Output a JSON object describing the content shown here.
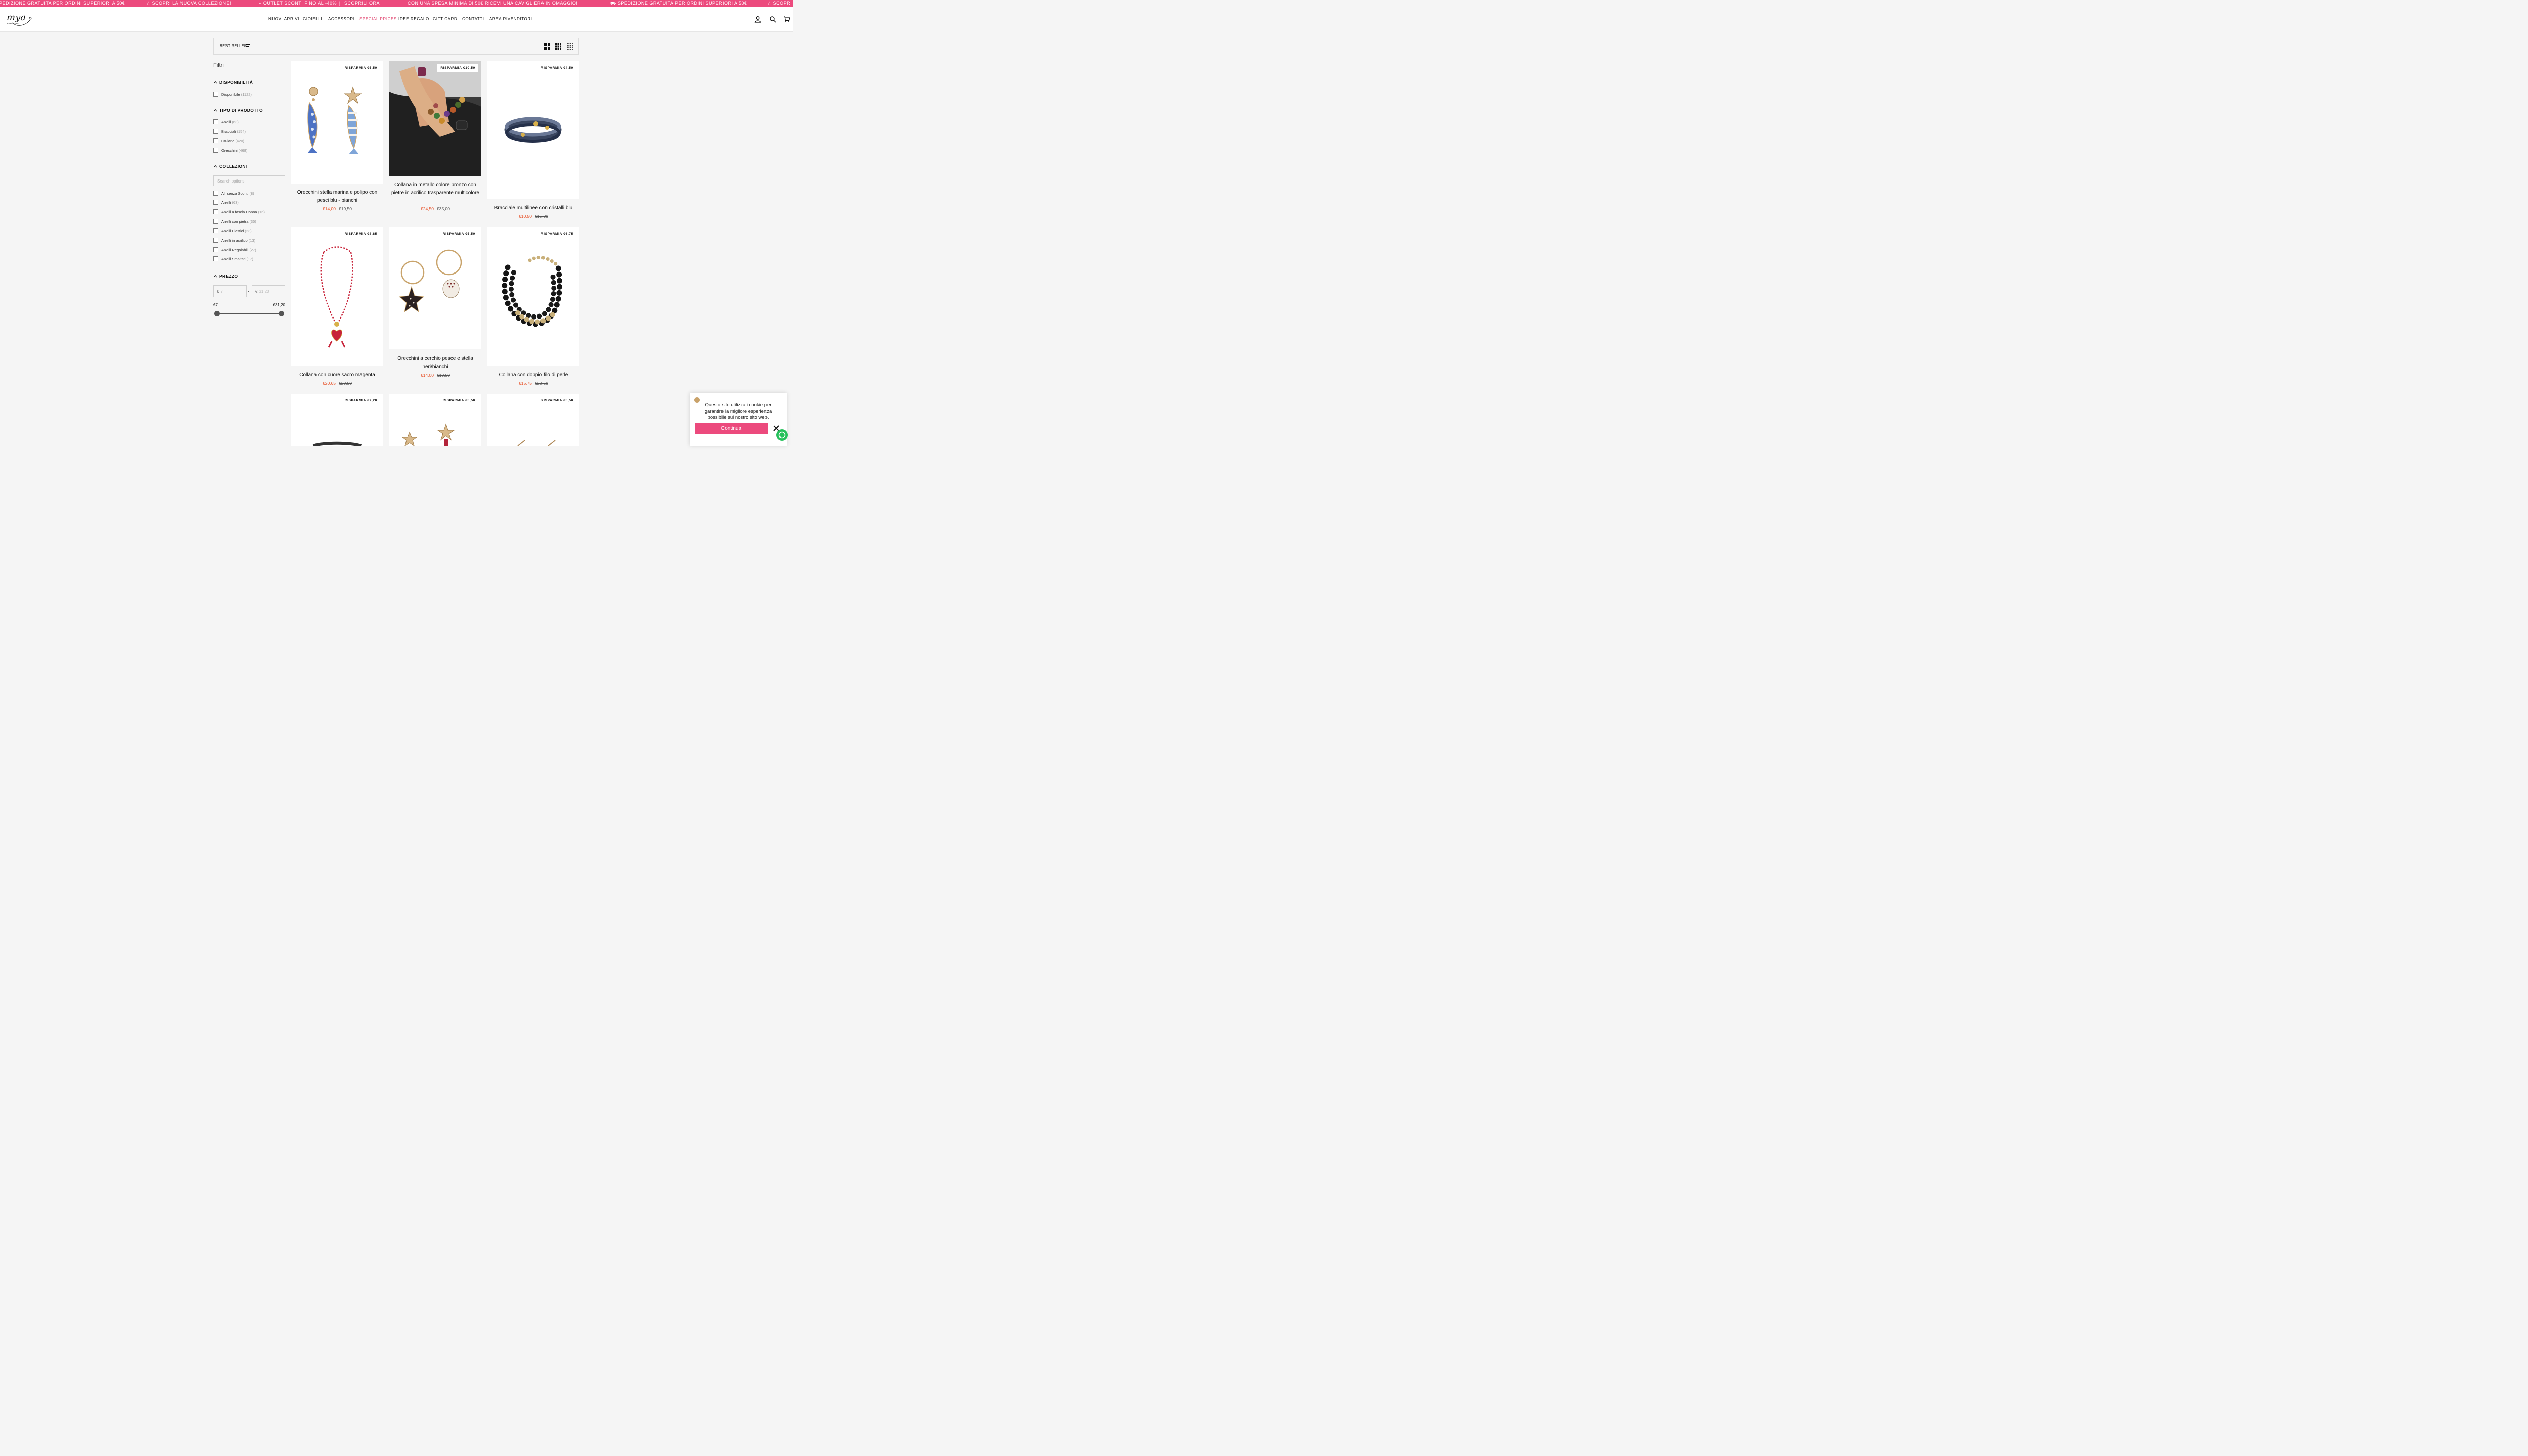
{
  "announcement": {
    "items": [
      "PEDIZIONE GRATUITA PER ORDINI SUPERIORI A 50€",
      "☆ SCOPRI LA NUOVA COLLEZIONE!",
      "⌁ OUTLET SCONTI FINO AL -40%",
      "SCOPRILI ORA",
      "CON UNA SPESA MINIMA DI 50€ RICEVI UNA CAVIGLIERA IN OMAGGIO!",
      "⛟ SPEDIZIONE GRATUITA PER ORDINI SUPERIORI A 50€",
      "☆ SCOPR"
    ]
  },
  "header": {
    "logo_text": "mya",
    "logo_sub": "accessories",
    "nav": [
      "NUOVI ARRIVI",
      "GIOIELLI",
      "ACCESSORI",
      "SPECIAL PRICES",
      "IDEE REGALO",
      "GIFT CARD",
      "CONTATTI",
      "AREA RIVENDITORI"
    ],
    "icons": [
      "account-icon",
      "search-icon",
      "cart-icon"
    ]
  },
  "toolbar": {
    "sort_label": "BEST SELLER"
  },
  "filters": {
    "title": "Filtri",
    "availability": {
      "title": "DISPONIBILITÀ",
      "options": [
        {
          "label": "Disponibile",
          "count": "(1122)"
        }
      ]
    },
    "product_type": {
      "title": "TIPO DI PRODOTTO",
      "options": [
        {
          "label": "Anelli",
          "count": "(63)"
        },
        {
          "label": "Bracciali",
          "count": "(154)"
        },
        {
          "label": "Collane",
          "count": "(420)"
        },
        {
          "label": "Orecchini",
          "count": "(468)"
        }
      ]
    },
    "collections": {
      "title": "COLLEZIONI",
      "search_placeholder": "Search options",
      "options": [
        {
          "label": "All senza Sconti",
          "count": "(8)"
        },
        {
          "label": "Anelli",
          "count": "(63)"
        },
        {
          "label": "Anelli a fascia Donna",
          "count": "(16)"
        },
        {
          "label": "Anelli con pietra",
          "count": "(35)"
        },
        {
          "label": "Anelli Elastici",
          "count": "(23)"
        },
        {
          "label": "Anelli in acrilico",
          "count": "(13)"
        },
        {
          "label": "Anelli Regolabili",
          "count": "(27)"
        },
        {
          "label": "Anelli Smaltati",
          "count": "(17)"
        }
      ]
    },
    "price": {
      "title": "PREZZO",
      "currency": "€",
      "min_placeholder": "7",
      "max_placeholder": "31,20",
      "dash": "-",
      "min_label": "€7",
      "max_label": "€31,20"
    }
  },
  "products": [
    {
      "badge": "RISPARMIA €5,50",
      "name": "Orecchini stella marina e polipo con pesci blu - bianchi",
      "price": "€14,00",
      "old_price": "€19,50"
    },
    {
      "badge": "RISPARMIA €10,50",
      "name": "Collana in metallo colore bronzo con pietre in acrilico trasparente multicolore",
      "price": "€24,50",
      "old_price": "€35,00"
    },
    {
      "badge": "RISPARMIA €4,50",
      "name": "Bracciale multilinee con cristalli blu",
      "price": "€10,50",
      "old_price": "€15,00"
    },
    {
      "badge": "RISPARMIA €8,85",
      "name": "Collana con cuore sacro magenta",
      "price": "€20,65",
      "old_price": "€29,50"
    },
    {
      "badge": "RISPARMIA €5,50",
      "name": "Orecchini a cerchio pesce e stella neri/bianchi",
      "price": "€14,00",
      "old_price": "€19,50"
    },
    {
      "badge": "RISPARMIA €6,75",
      "name": "Collana con doppio filo di perle",
      "price": "€15,75",
      "old_price": "€22,50"
    },
    {
      "badge": "RISPARMIA €7,20",
      "name": "",
      "price": "",
      "old_price": ""
    },
    {
      "badge": "RISPARMIA €5,50",
      "name": "",
      "price": "",
      "old_price": ""
    },
    {
      "badge": "RISPARMIA €5,50",
      "name": "",
      "price": "",
      "old_price": ""
    }
  ],
  "cookie": {
    "message": "Questo sito utilizza i cookie per garantire la migliore esperienza possibile sul nostro sito web.",
    "button": "Continua"
  },
  "colors": {
    "accent": "#ec4a7d",
    "sale": "#e8532a",
    "whatsapp": "#25c05a"
  }
}
